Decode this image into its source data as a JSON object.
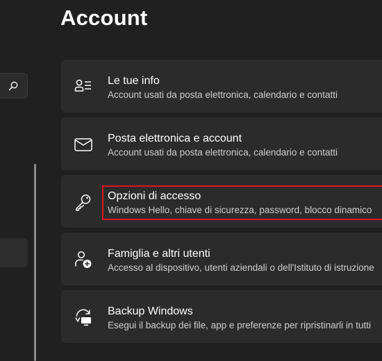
{
  "page": {
    "title": "Account"
  },
  "sidebar": {
    "search_icon": "search-icon"
  },
  "cards": [
    {
      "id": "info",
      "icon": "person-details-icon",
      "title": "Le tue info",
      "subtitle": "Account usati da posta elettronica, calendario e contatti"
    },
    {
      "id": "email",
      "icon": "mail-icon",
      "title": "Posta elettronica e account",
      "subtitle": "Account usati da posta elettronica, calendario e contatti"
    },
    {
      "id": "signin",
      "icon": "key-icon",
      "title": "Opzioni di accesso",
      "subtitle": "Windows Hello, chiave di sicurezza, password, blocco dinamico",
      "highlighted": true
    },
    {
      "id": "family",
      "icon": "family-add-icon",
      "title": "Famiglia e altri utenti",
      "subtitle": "Accesso al dispositivo, utenti aziendali o dell'Istituto di istruzione"
    },
    {
      "id": "backup",
      "icon": "backup-icon",
      "title": "Backup Windows",
      "subtitle": "Esegui il backup dei file, app e preferenze per ripristinarli in tutti"
    }
  ],
  "colors": {
    "background": "#202020",
    "card": "#2b2b2b",
    "highlight": "#e0141e"
  }
}
